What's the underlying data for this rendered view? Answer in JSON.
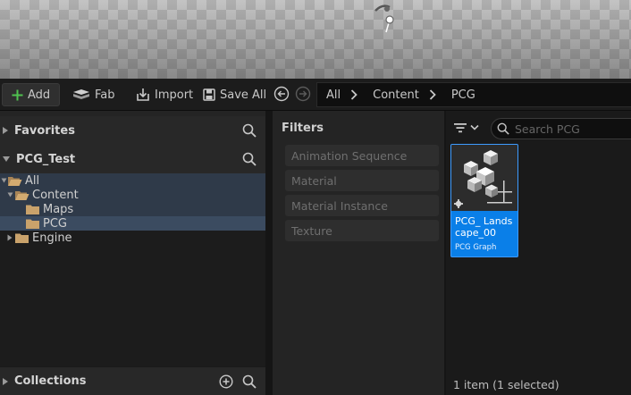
{
  "toolbar": {
    "add_label": "Add",
    "fab_label": "Fab",
    "import_label": "Import",
    "save_all_label": "Save All"
  },
  "breadcrumb": [
    "All",
    "Content",
    "PCG"
  ],
  "left_panel": {
    "favorites_label": "Favorites",
    "project_label": "PCG_Test",
    "tree": [
      {
        "label": "All",
        "state": "expanded"
      },
      {
        "label": "Content",
        "state": "expanded"
      },
      {
        "label": "Maps",
        "state": "leaf"
      },
      {
        "label": "PCG",
        "state": "selected"
      },
      {
        "label": "Engine",
        "state": "collapsed"
      }
    ],
    "collections_label": "Collections"
  },
  "filters": {
    "title": "Filters",
    "items": [
      "Animation Sequence",
      "Material",
      "Material Instance",
      "Texture"
    ]
  },
  "assets": {
    "search_placeholder": "Search PCG",
    "items": [
      {
        "name": "PCG_ Landscape_00",
        "type": "PCG Graph",
        "selected": true
      }
    ],
    "status": "1 item (1 selected)"
  },
  "colors": {
    "selection_blue": "#0a7fe8",
    "add_icon_green": "#4fc24f",
    "folder_tan": "#c9a26b",
    "tree_selected": "#3b4b60"
  },
  "icons": [
    "plus-icon",
    "fab-icon",
    "import-icon",
    "save-icon",
    "back-icon",
    "forward-icon",
    "chevron-right-icon",
    "search-icon",
    "folder-icon",
    "filter-icon",
    "chevron-down-icon",
    "add-circle-icon",
    "pcg-graph-icon"
  ]
}
